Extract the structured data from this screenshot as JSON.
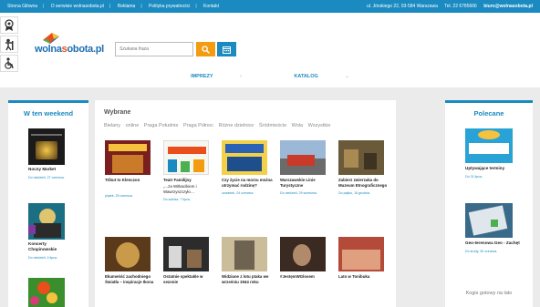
{
  "topbar": {
    "links": [
      "Strona Główna",
      "O serwisie wolnasobota.pl",
      "Reklama",
      "Polityka prywatności",
      "Kontakt"
    ],
    "address": "ul. Jórskiego 22, 03-584 Warszawa",
    "phone": "Tel. 22 6785666",
    "email": "biuro@wolnasobota.pl"
  },
  "logo": {
    "part1": "wolna",
    "accent": "s",
    "part2": "obota.pl"
  },
  "search": {
    "placeholder": "Szukana fraza"
  },
  "nav": [
    {
      "label": "IMPREZY",
      "caret": "›"
    },
    {
      "label": "KATALOG",
      "caret": "⌄"
    }
  ],
  "left_sidebar": {
    "title": "W ten weekend",
    "items": [
      {
        "title": "Nocny Market",
        "date": "Do niedzieli, 27 czerwca."
      },
      {
        "title": "Koncerty Chopinowskie",
        "date": "Do niedzieli, 4 lipca."
      },
      {
        "title": "",
        "date": ""
      }
    ]
  },
  "center": {
    "title": "Wybrane",
    "filters": [
      "Bielany",
      "online",
      "Praga Południe",
      "Praga Północ",
      "Różne dzielnice",
      "Śródmieście",
      "Wola",
      "Wszystkie"
    ],
    "row1": [
      {
        "title": "Tribut to Klenczon",
        "date": "piątek, 25 czerwca."
      },
      {
        "title": "Teatr Familijny",
        "sub": "„...za Witkacikiem i Wawrzyszczyło…",
        "date": "Do sobota, 7 lipca."
      },
      {
        "title": "Czy życie na morzu można utrzymać rodzinę?",
        "date": "czwartek, 24 czerwca."
      },
      {
        "title": "Warszawskie Linie Turystyczne",
        "date": "Do niedzieli, 29 września."
      },
      {
        "title": "Zabierz zwierzaka do Muzeum Etnograficznego",
        "date": "Do piątku, 18 grudnia."
      }
    ],
    "row2": [
      {
        "title": "Ekumeńść zachodniego Światła – inspiracje Ikona",
        "date": ""
      },
      {
        "title": "Ostatnie spektakle w sezonie",
        "date": ""
      },
      {
        "title": "Widziane z lotu ptaka we wrześniu 1944 roku",
        "date": ""
      },
      {
        "title": "#JestęmWGlosem",
        "date": ""
      },
      {
        "title": "Lato w Tonibuka",
        "date": ""
      }
    ]
  },
  "right_sidebar": {
    "title": "Polecane",
    "items": [
      {
        "title": "Uptywające terminy",
        "date": "Do 31 lipca."
      },
      {
        "title": "Geo-terenowa Geo - Zachęt",
        "date": "Do środy, 30 czerwca."
      }
    ],
    "box_text": "Kogis gotowy na lato"
  },
  "colors": {
    "accent": "#1a8ac0",
    "orange": "#f39c12"
  }
}
